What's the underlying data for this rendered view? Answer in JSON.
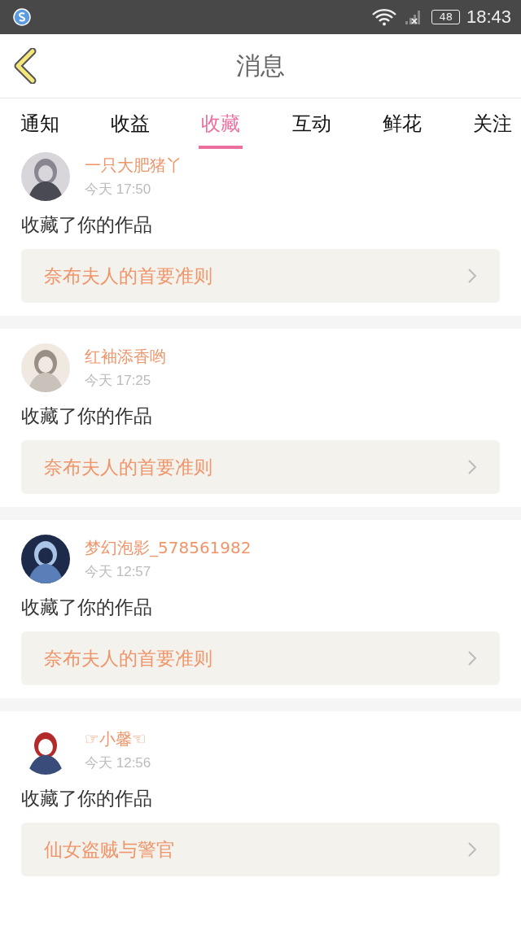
{
  "status_bar": {
    "time": "18:43",
    "battery": "48"
  },
  "header": {
    "title": "消息"
  },
  "tabs": [
    {
      "label": "通知",
      "selected": false
    },
    {
      "label": "收益",
      "selected": false
    },
    {
      "label": "收藏",
      "selected": true
    },
    {
      "label": "互动",
      "selected": false
    },
    {
      "label": "鲜花",
      "selected": false
    },
    {
      "label": "关注",
      "selected": false
    }
  ],
  "messages": [
    {
      "user": "一只大肥猪丫",
      "time": "今天 17:50",
      "text": "收藏了你的作品",
      "work": "奈布夫人的首要准则"
    },
    {
      "user": "红袖添香哟",
      "time": "今天 17:25",
      "text": "收藏了你的作品",
      "work": "奈布夫人的首要准则"
    },
    {
      "user": "梦幻泡影_578561982",
      "time": "今天 12:57",
      "text": "收藏了你的作品",
      "work": "奈布夫人的首要准则"
    },
    {
      "user": "☞小馨☜",
      "time": "今天 12:56",
      "text": "收藏了你的作品",
      "work": "仙女盗贼与警官"
    }
  ]
}
